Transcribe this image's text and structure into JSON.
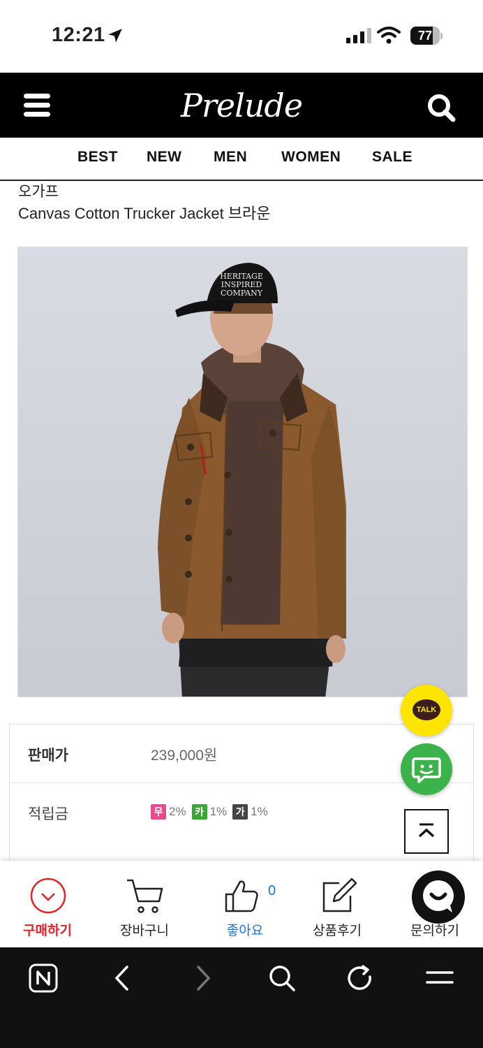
{
  "status_bar": {
    "time": "12:21",
    "battery": "77",
    "battery_level": 0.77
  },
  "header": {
    "logo": "Prelude"
  },
  "categories": [
    {
      "label": "BEST"
    },
    {
      "label": "NEW"
    },
    {
      "label": "MEN"
    },
    {
      "label": "WOMEN"
    },
    {
      "label": "SALE"
    }
  ],
  "product": {
    "brand": "오가프",
    "name": "Canvas Cotton Trucker Jacket 브라운",
    "cap_text": [
      "HERITAGE",
      "INSPIRED",
      "COMPANY"
    ]
  },
  "info": {
    "price_label": "판매가",
    "price_value": "239,000원",
    "points_label": "적립금",
    "points": [
      {
        "badge": "무",
        "rate": "2%",
        "color": "#e84a8a"
      },
      {
        "badge": "카",
        "rate": "1%",
        "color": "#3aa635"
      },
      {
        "badge": "가",
        "rate": "1%",
        "color": "#444444"
      }
    ]
  },
  "floating": {
    "talk_label": "TALK"
  },
  "actions": {
    "buy": "구매하기",
    "cart": "장바구니",
    "like": "좋아요",
    "like_count": "0",
    "review": "상품후기",
    "inquiry": "문의하기"
  },
  "colors": {
    "accent_red": "#e8202a",
    "like_blue": "#1a73e8",
    "kakao_yellow": "#fee500",
    "chat_green": "#3cb24a"
  }
}
